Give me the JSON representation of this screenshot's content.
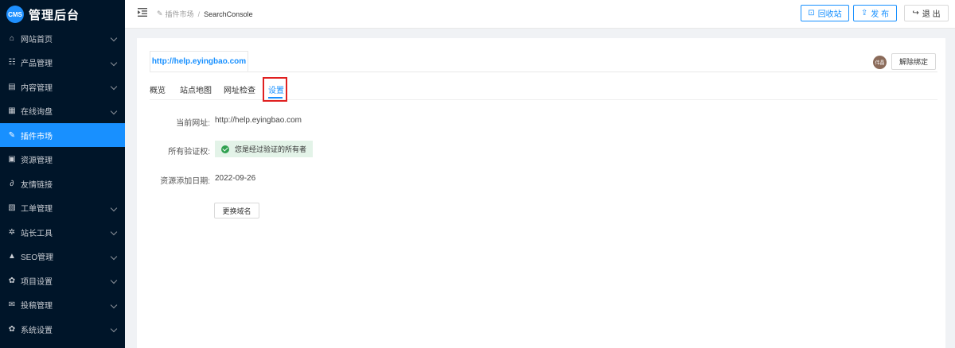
{
  "sidebar": {
    "logo_badge": "CMS",
    "title": "管理后台",
    "items": [
      {
        "label": "网站首页",
        "icon": "home-icon",
        "expandable": true,
        "active": false
      },
      {
        "label": "产品管理",
        "icon": "product-icon",
        "expandable": true,
        "active": false
      },
      {
        "label": "内容管理",
        "icon": "content-icon",
        "expandable": true,
        "active": false
      },
      {
        "label": "在线询盘",
        "icon": "inquiry-icon",
        "expandable": true,
        "active": false
      },
      {
        "label": "插件市场",
        "icon": "pin-icon",
        "expandable": false,
        "active": true
      },
      {
        "label": "资源管理",
        "icon": "grid-icon",
        "expandable": false,
        "active": false
      },
      {
        "label": "友情链接",
        "icon": "link-icon",
        "expandable": false,
        "active": false
      },
      {
        "label": "工单管理",
        "icon": "ticket-icon",
        "expandable": true,
        "active": false
      },
      {
        "label": "站长工具",
        "icon": "tools-icon",
        "expandable": true,
        "active": false
      },
      {
        "label": "SEO管理",
        "icon": "warning-icon",
        "expandable": true,
        "active": false
      },
      {
        "label": "项目设置",
        "icon": "gear-icon",
        "expandable": true,
        "active": false
      },
      {
        "label": "投稿管理",
        "icon": "mail-icon",
        "expandable": true,
        "active": false
      },
      {
        "label": "系统设置",
        "icon": "settings-icon",
        "expandable": true,
        "active": false
      }
    ]
  },
  "header": {
    "breadcrumb_parent": "插件市场",
    "breadcrumb_sep": "/",
    "breadcrumb_current": "SearchConsole",
    "recycle_label": "回收站",
    "publish_label": "发 布",
    "logout_label": "退 出"
  },
  "main": {
    "domain_tab": "http://help.eyingbao.com",
    "avatar_text": "伟晶",
    "unbind_label": "解除绑定",
    "tabs": [
      {
        "label": "概览",
        "active": false
      },
      {
        "label": "站点地图",
        "active": false
      },
      {
        "label": "网址检查",
        "active": false
      },
      {
        "label": "设置",
        "active": true
      }
    ],
    "current_url_label": "当前网址:",
    "current_url_value": "http://help.eyingbao.com",
    "owner_label": "所有验证权:",
    "owner_value": "您是经过验证的所有者",
    "added_date_label": "资源添加日期:",
    "added_date_value": "2022-09-26",
    "change_domain_label": "更换域名"
  },
  "colors": {
    "sidebar_bg": "#001529",
    "accent": "#1890ff",
    "highlight_border": "#e02020",
    "verified_bg": "#e3f3e8",
    "verified_icon": "#2fa04f"
  }
}
